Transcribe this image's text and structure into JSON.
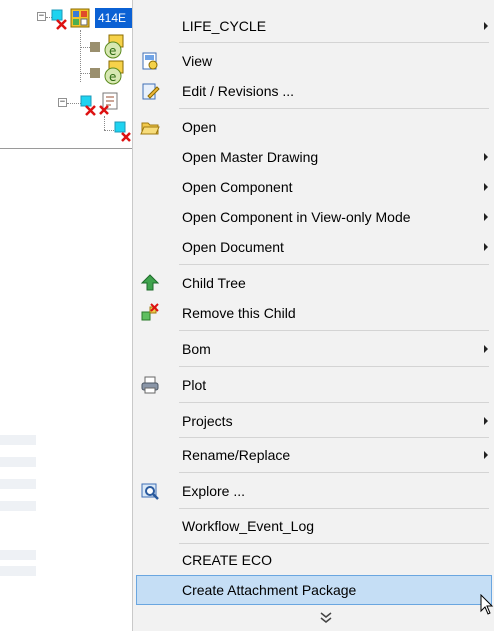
{
  "tree": {
    "root_label": "414E"
  },
  "menu": {
    "items": [
      {
        "label": "LIFE_CYCLE",
        "submenu": true,
        "icon": null
      },
      {
        "label": "View",
        "submenu": false,
        "icon": "view-icon"
      },
      {
        "label": "Edit / Revisions ...",
        "submenu": false,
        "icon": "edit-icon"
      },
      {
        "label": "Open",
        "submenu": false,
        "icon": "open-folder-icon"
      },
      {
        "label": "Open Master Drawing",
        "submenu": true,
        "icon": null
      },
      {
        "label": "Open Component",
        "submenu": true,
        "icon": null
      },
      {
        "label": "Open Component in View-only Mode",
        "submenu": true,
        "icon": null
      },
      {
        "label": "Open Document",
        "submenu": true,
        "icon": null
      },
      {
        "label": "Child Tree",
        "submenu": false,
        "icon": "child-tree-icon"
      },
      {
        "label": "Remove this Child",
        "submenu": false,
        "icon": "remove-child-icon"
      },
      {
        "label": "Bom",
        "submenu": true,
        "icon": null
      },
      {
        "label": "Plot",
        "submenu": false,
        "icon": "printer-icon"
      },
      {
        "label": "Projects",
        "submenu": true,
        "icon": null
      },
      {
        "label": "Rename/Replace",
        "submenu": true,
        "icon": null
      },
      {
        "label": "Explore ...",
        "submenu": false,
        "icon": "explore-icon"
      },
      {
        "label": "Workflow_Event_Log",
        "submenu": false,
        "icon": null
      },
      {
        "label": "CREATE ECO",
        "submenu": false,
        "icon": null
      },
      {
        "label": "Create Attachment Package",
        "submenu": false,
        "icon": null,
        "highlighted": true
      }
    ],
    "more_icon": "double-chevron-down-icon"
  }
}
